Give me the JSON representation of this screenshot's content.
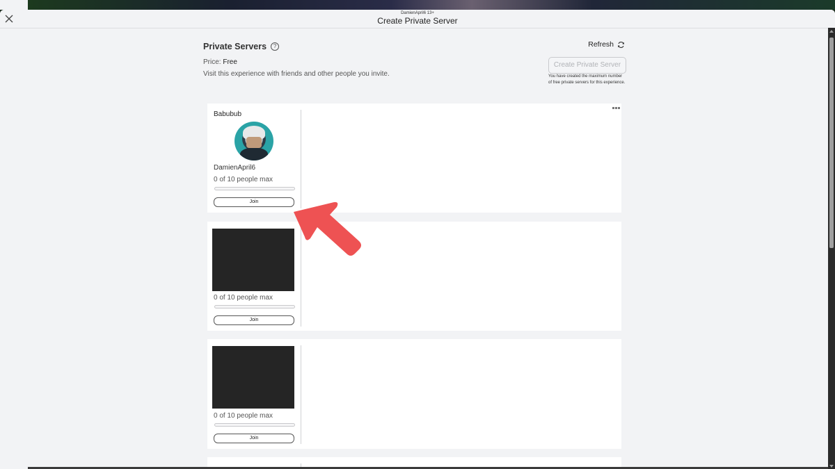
{
  "header": {
    "subtitle": "DamienApril6 13+",
    "title": "Create Private Server",
    "close_icon": "close-icon"
  },
  "section": {
    "title": "Private Servers",
    "help_icon": "?",
    "price_label": "Price:",
    "price_value": "Free",
    "description": "Visit this experience with friends and other people you invite.",
    "refresh_label": "Refresh",
    "refresh_icon": "⟳",
    "create_button_label": "Create Private Server",
    "create_button_disabled": true,
    "create_note": "You have created the maximum number of free private servers for this experience."
  },
  "servers": [
    {
      "name": "Babubub",
      "owner": "DamienApril6",
      "capacity_text": "0 of 10 people max",
      "fill_fraction": 0.0,
      "join_label": "Join",
      "has_avatar": true
    },
    {
      "name": "",
      "owner": "",
      "capacity_text": "0 of 10 people max",
      "fill_fraction": 0.0,
      "join_label": "Join",
      "has_avatar": false
    },
    {
      "name": "",
      "owner": "",
      "capacity_text": "0 of 10 people max",
      "fill_fraction": 0.0,
      "join_label": "Join",
      "has_avatar": false
    }
  ],
  "annotation": {
    "arrow_color": "#ee5253"
  }
}
